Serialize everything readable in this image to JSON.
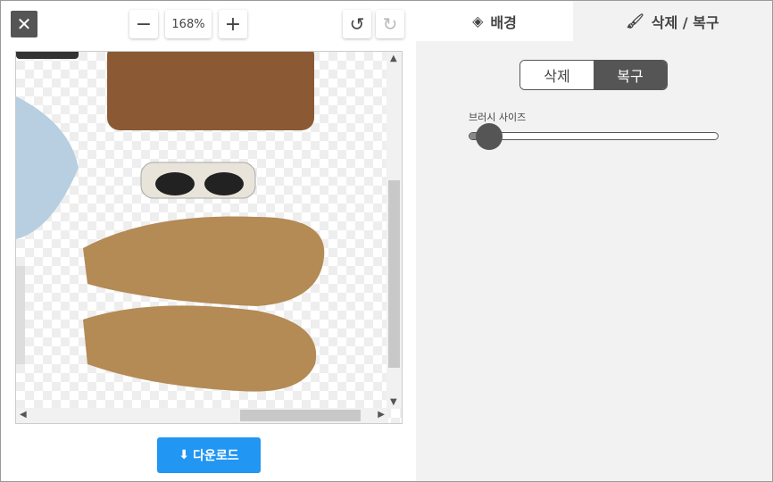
{
  "toolbar": {
    "close_icon": "close-icon",
    "zoom_out": "−",
    "zoom_level": "168%",
    "zoom_in": "+",
    "undo_icon": "undo-icon",
    "redo_icon": "redo-icon"
  },
  "tabs": [
    {
      "label": "배경",
      "icon": "layers-icon"
    },
    {
      "label": "삭제 / 복구",
      "icon": "brush-icon",
      "active": true
    }
  ],
  "mode": {
    "erase": "삭제",
    "restore": "복구",
    "selected": "복구"
  },
  "brush": {
    "label": "브러시 사이즈",
    "value_percent": 8
  },
  "download": {
    "label": "다운로드",
    "icon": "download-icon"
  },
  "colors": {
    "accent": "#2196f3",
    "dark": "#555555"
  }
}
